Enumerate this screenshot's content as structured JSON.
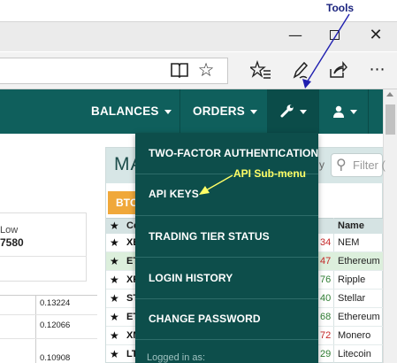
{
  "annotations": {
    "tools_label": "Tools",
    "api_label": "API Sub-menu",
    "color": "#ffff66",
    "arrow_color": "#1f1fb0"
  },
  "browser": {
    "window_controls": [
      "minimize-icon",
      "maximize-icon",
      "close-icon"
    ],
    "toolbar_icons": [
      "reading-view-icon",
      "favorite-star-icon",
      "favorites-list-icon",
      "notes-pen-icon",
      "share-icon",
      "more-icon"
    ]
  },
  "nav": {
    "balances": "BALANCES",
    "orders": "ORDERS",
    "tools_icon": "wrench-icon",
    "account_icon": "user-icon"
  },
  "dropdown": {
    "items": [
      "TWO-FACTOR AUTHENTICATION",
      "API KEYS",
      "TRADING TIER STATUS",
      "LOGIN HISTORY",
      "CHANGE PASSWORD"
    ],
    "footer": "Logged in as:"
  },
  "left_panel": {
    "low_label": "Low",
    "low_value": "7580",
    "mini_values": [
      "0.13224",
      "0.12066",
      "0.10908"
    ]
  },
  "markets": {
    "title_partial": "MA",
    "filter_placeholder": "Filter (",
    "y_partial": "y",
    "tab": "BTC",
    "header_col": "Co",
    "header_name": "Name",
    "rows": [
      {
        "ticker": "XE",
        "change": "34",
        "color": "#c62828",
        "name": "NEM"
      },
      {
        "ticker": "ET",
        "change": "47",
        "color": "#c62828",
        "name": "Ethereum"
      },
      {
        "ticker": "XR",
        "change": "76",
        "color": "#2e7d32",
        "name": "Ripple"
      },
      {
        "ticker": "ST",
        "change": "40",
        "color": "#2e7d32",
        "name": "Stellar"
      },
      {
        "ticker": "ET",
        "change": "68",
        "color": "#2e7d32",
        "name": "Ethereum"
      },
      {
        "ticker": "XM",
        "change": "72",
        "color": "#c62828",
        "name": "Monero"
      },
      {
        "ticker": "LT",
        "change": "29",
        "color": "#2e7d32",
        "name": "Litecoin"
      }
    ]
  },
  "colors": {
    "nav_bg": "#0f5f5c",
    "dropdown_bg": "#0d4e4b",
    "btc_tab": "#f0a83a"
  }
}
